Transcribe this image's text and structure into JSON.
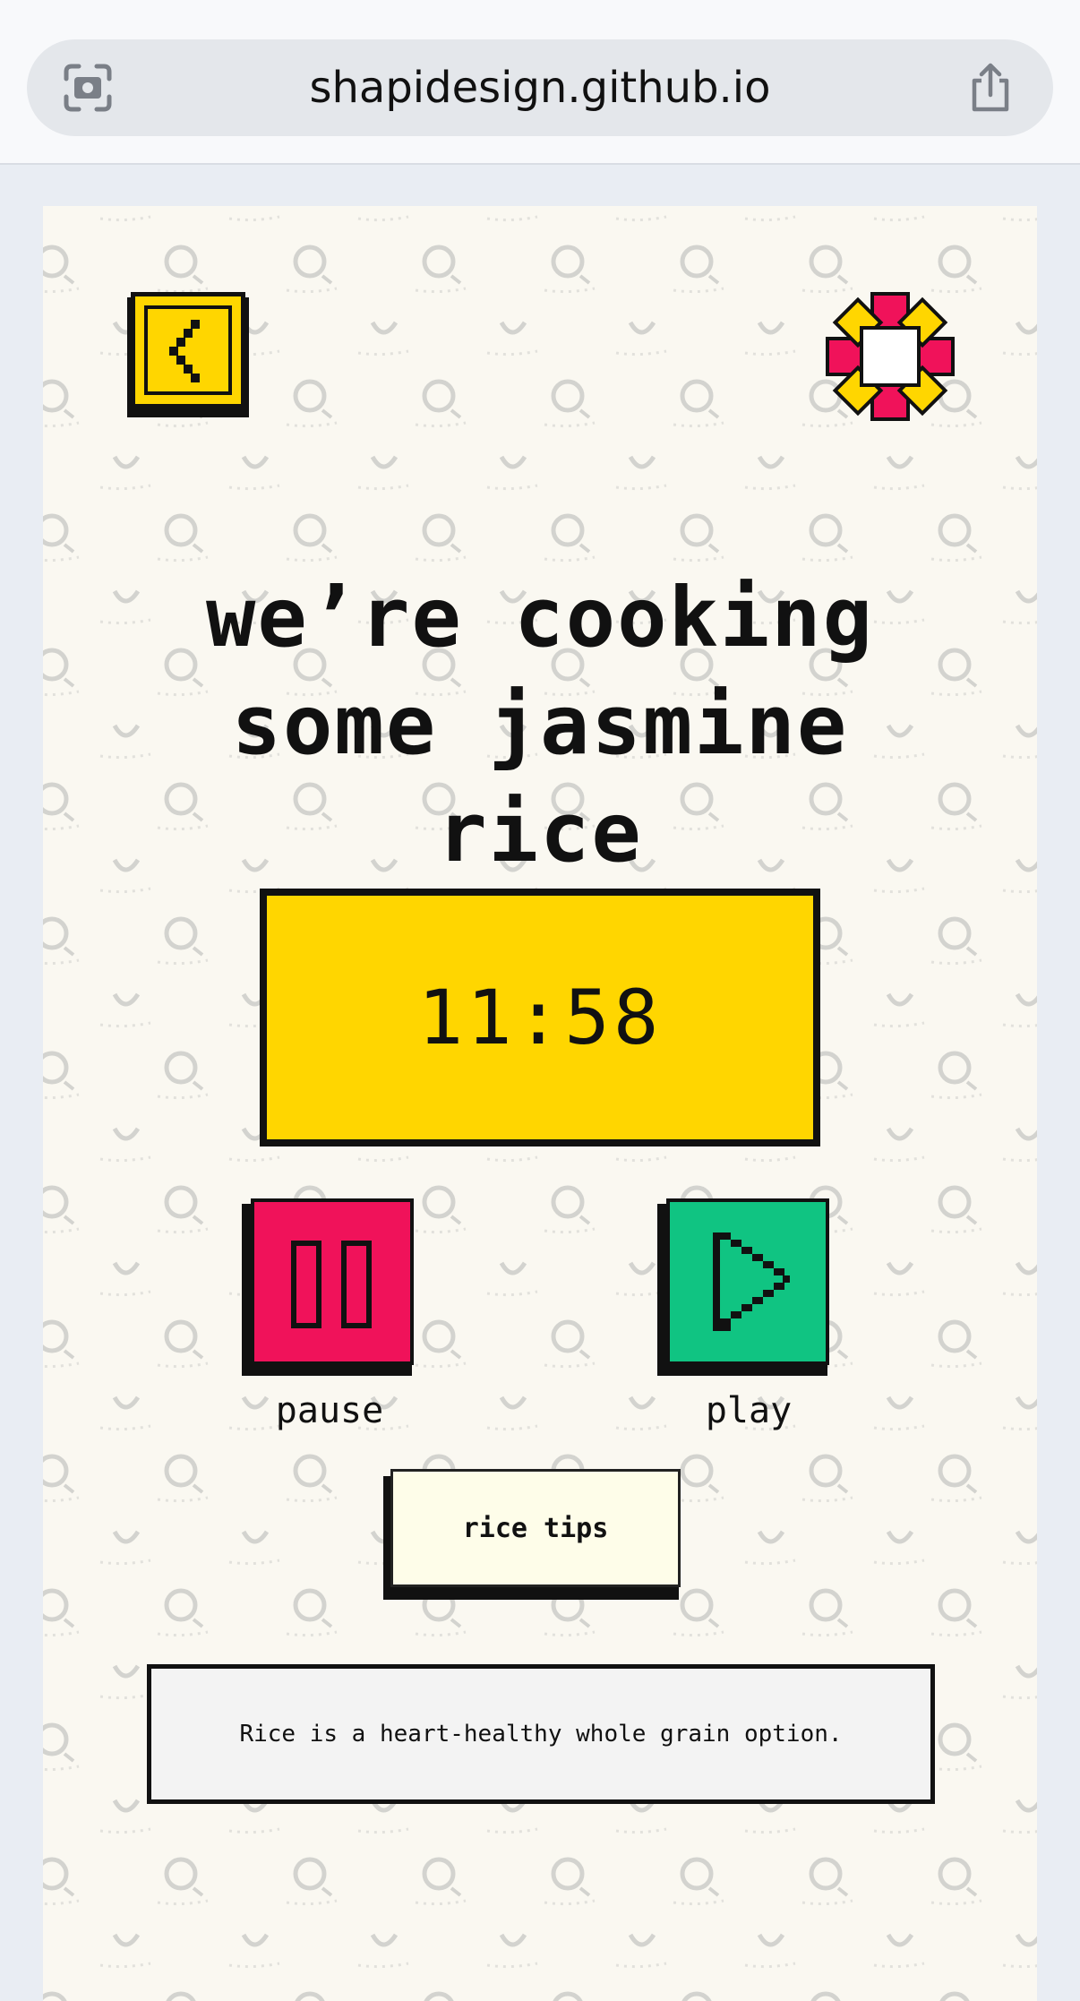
{
  "browser": {
    "url": "shapidesign.github.io",
    "left_icon": "camera-scan-icon",
    "right_icon": "share-icon"
  },
  "app": {
    "back_icon": "chevron-left-icon",
    "menu_icon": "pixel-flower-icon",
    "headline_lines": [
      "we’re cooking",
      "some jasmine",
      "rice"
    ],
    "timer": "11:58",
    "pause_label": "pause",
    "play_label": "play",
    "tips_button_label": "rice tips",
    "tip_text": "Rice is a heart-healthy whole grain option.",
    "colors": {
      "yellow": "#ffd600",
      "pink": "#f0125a",
      "green": "#10c482",
      "background": "#faf8f1"
    }
  }
}
